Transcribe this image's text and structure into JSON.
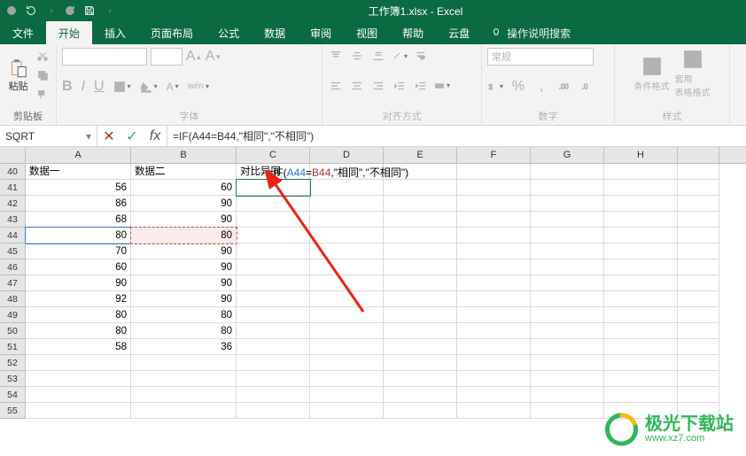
{
  "titlebar": {
    "title": "工作簿1.xlsx - Excel"
  },
  "tabs": {
    "file": "文件",
    "home": "开始",
    "insert": "插入",
    "layout": "页面布局",
    "formulas": "公式",
    "data": "数据",
    "review": "审阅",
    "view": "视图",
    "help": "帮助",
    "cloud": "云盘",
    "tellme": "操作说明搜索"
  },
  "ribbon": {
    "clipboard": {
      "paste": "粘贴",
      "group": "剪贴板"
    },
    "font": {
      "group": "字体",
      "bold": "B",
      "italic": "I",
      "underline": "U"
    },
    "align": {
      "group": "对齐方式"
    },
    "number": {
      "group": "数字",
      "format": "常规"
    },
    "styles": {
      "group": "样式",
      "cond": "条件格式",
      "table": "套用\n表格格式"
    }
  },
  "namebox": {
    "value": "SQRT"
  },
  "formula_bar": {
    "text": "=IF(A44=B44,\"相同\",\"不相同\")"
  },
  "columns": [
    "A",
    "B",
    "C",
    "D",
    "E",
    "F",
    "G",
    "H"
  ],
  "rows_idx": [
    40,
    41,
    42,
    43,
    44,
    45,
    46,
    47,
    48,
    49,
    50,
    51,
    52,
    53,
    54,
    55
  ],
  "headers": {
    "a": "数据一",
    "b": "数据二",
    "c": "对比异同"
  },
  "table": {
    "A": {
      "41": "56",
      "42": "86",
      "43": "68",
      "44": "80",
      "45": "70",
      "46": "60",
      "47": "90",
      "48": "92",
      "49": "80",
      "50": "80",
      "51": "58"
    },
    "B": {
      "41": "60",
      "42": "90",
      "43": "90",
      "44": "80",
      "45": "90",
      "46": "90",
      "47": "90",
      "48": "90",
      "49": "80",
      "50": "80",
      "51": "36"
    }
  },
  "cell_formula": {
    "prefix": "=IF",
    "open": "(",
    "ref1": "A44",
    "eq": "=",
    "ref2": "B44",
    "rest": ",\"相同\",\"不相同\")"
  },
  "watermark": {
    "brand": "极光下载站",
    "url": "www.xz7.com"
  }
}
